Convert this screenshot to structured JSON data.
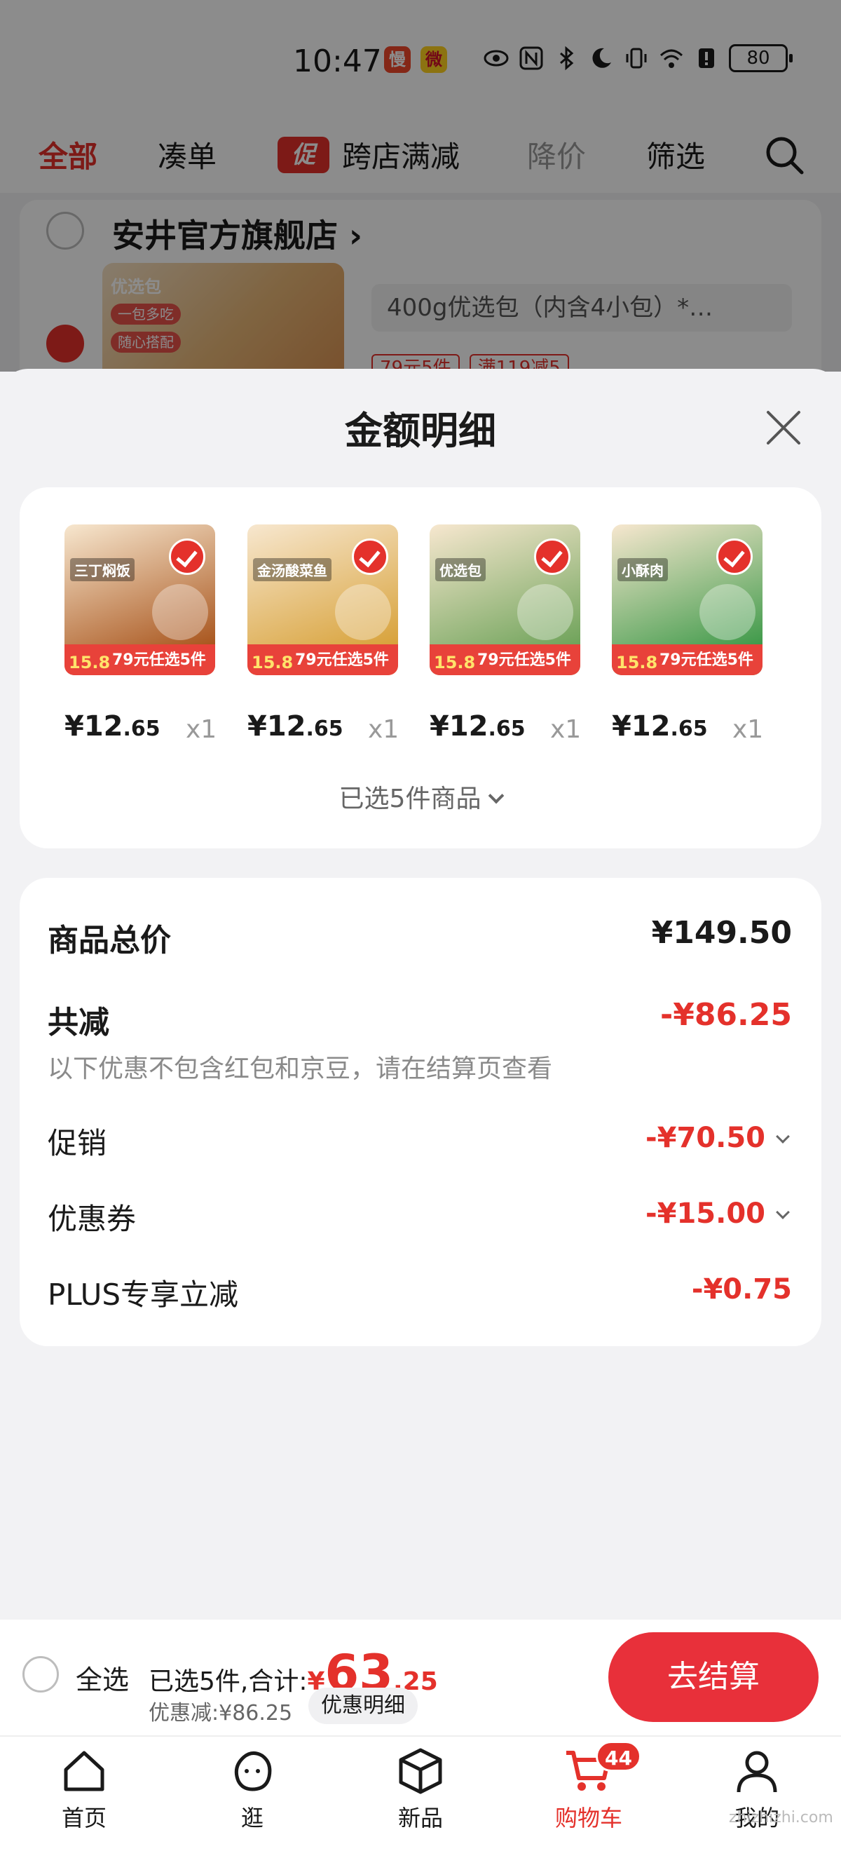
{
  "status_bar": {
    "time": "10:47",
    "battery": "80",
    "app_badges": [
      "慢",
      "微"
    ]
  },
  "tabs": {
    "all": "全部",
    "bundle": "凑单",
    "promo_tag": "促",
    "cross_store": "跨店满减",
    "price_drop": "降价",
    "filter": "筛选"
  },
  "store": {
    "name": "安井官方旗舰店 ›",
    "thumb_label": "优选包",
    "thumb_pills": [
      "一包多吃",
      "随心搭配"
    ],
    "variant": "400g优选包（内含4小包）*…",
    "tags": [
      "79元5件",
      "满119减5"
    ]
  },
  "sheet": {
    "title": "金额明细",
    "products": [
      {
        "name": "三丁焖饭",
        "price_main": "¥12",
        "price_cents": ".65",
        "qty": "x1",
        "tag_price": "15.8",
        "tag_offer": "79元任选5件",
        "color": "#a9561e"
      },
      {
        "name": "金汤酸菜鱼",
        "price_main": "¥12",
        "price_cents": ".65",
        "qty": "x1",
        "tag_price": "15.8",
        "tag_offer": "79元任选5件",
        "color": "#d8a23a"
      },
      {
        "name": "优选包",
        "price_main": "¥12",
        "price_cents": ".65",
        "qty": "x1",
        "tag_price": "15.8",
        "tag_offer": "79元任选5件",
        "color": "#6fa35a"
      },
      {
        "name": "小酥肉",
        "price_main": "¥12",
        "price_cents": ".65",
        "qty": "x1",
        "tag_price": "15.8",
        "tag_offer": "79元任选5件",
        "color": "#3f9a4a"
      }
    ],
    "selected_summary": "已选5件商品",
    "totals": {
      "goods_total_label": "商品总价",
      "goods_total_value": "¥149.50",
      "total_discount_label": "共减",
      "total_discount_value": "-¥86.25",
      "note": "以下优惠不包含红包和京豆，请在结算页查看",
      "promo_label": "促销",
      "promo_value": "-¥70.50",
      "coupon_label": "优惠券",
      "coupon_value": "-¥15.00",
      "plus_label": "PLUS专享立减",
      "plus_value": "-¥0.75"
    }
  },
  "checkout": {
    "select_all": "全选",
    "selected_prefix": "已选5件,合计:",
    "currency": "¥",
    "total_main": "63",
    "total_cents": ".25",
    "discount_line": "优惠减:¥86.25",
    "detail_chip": "优惠明细",
    "button": "去结算"
  },
  "nav": {
    "home": "首页",
    "browse": "逛",
    "new": "新品",
    "cart": "购物车",
    "cart_badge": "44",
    "me": "我的"
  },
  "watermark": "zhizhizhi.com",
  "colors": {
    "accent": "#e4312b",
    "checkout_button": "#e8303a"
  }
}
